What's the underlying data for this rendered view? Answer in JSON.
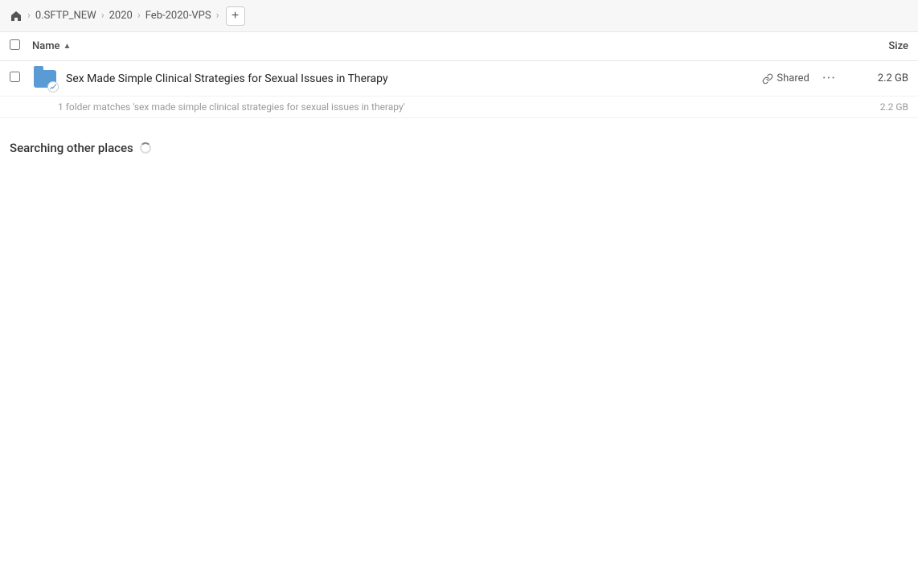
{
  "toolbar": {
    "home_icon": "home",
    "breadcrumb": [
      {
        "label": "0.SFTP_NEW"
      },
      {
        "label": "2020"
      },
      {
        "label": "Feb-2020-VPS"
      }
    ],
    "add_tab_label": "+"
  },
  "columns": {
    "name_label": "Name",
    "sort_indicator": "▲",
    "size_label": "Size"
  },
  "file_row": {
    "icon_type": "folder-link",
    "name": "Sex Made Simple Clinical Strategies for Sexual Issues in Therapy",
    "shared_label": "Shared",
    "more_icon": "···",
    "size": "2.2 GB"
  },
  "match_row": {
    "text": "1 folder matches 'sex made simple clinical strategies for sexual issues in therapy'",
    "size": "2.2 GB"
  },
  "searching_section": {
    "title": "Searching other places",
    "spinner": true
  }
}
